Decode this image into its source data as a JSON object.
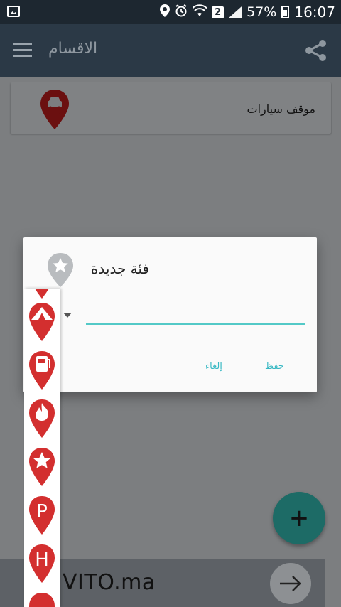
{
  "status_bar": {
    "battery_percent": "57%",
    "time": "16:07",
    "sim_slot": "2"
  },
  "toolbar": {
    "title": "الاقسام"
  },
  "categories": [
    {
      "label": "موقف سيارات",
      "icon": "car-icon"
    }
  ],
  "ad": {
    "text": "VITO.ma"
  },
  "dialog": {
    "title": "فئة جديدة",
    "input_value": "",
    "save_label": "حفظ",
    "cancel_label": "إلغاء"
  },
  "icon_picker": {
    "icons": [
      "tent-icon",
      "fuel-icon",
      "fire-icon",
      "star-icon",
      "parking-icon",
      "hospital-icon"
    ]
  },
  "colors": {
    "accent": "#53c9c7",
    "pin_red": "#d32f2f",
    "toolbar": "#2b3946",
    "fab": "#1d6b66"
  }
}
